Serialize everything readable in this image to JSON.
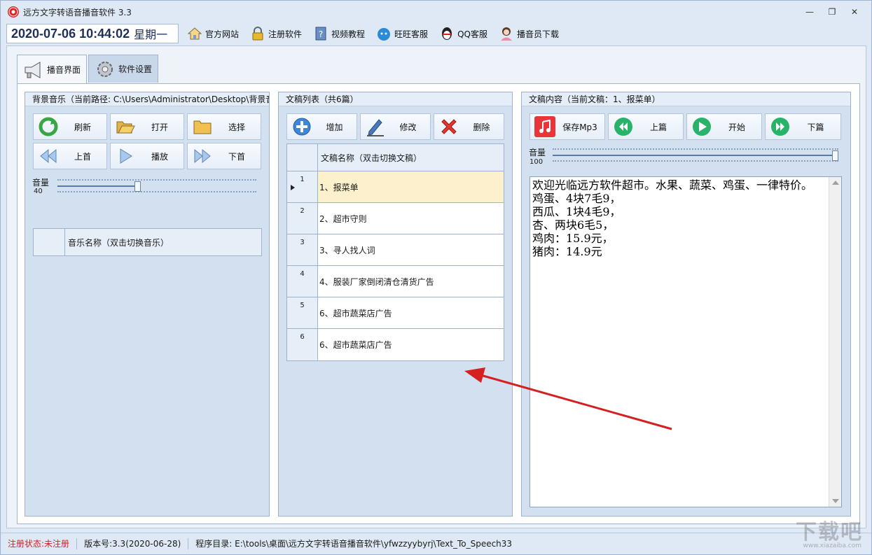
{
  "window": {
    "title": "远方文字转语音播音软件 3.3",
    "controls": {
      "minimize": "—",
      "restore": "❐",
      "close": "✕"
    }
  },
  "toolbar": {
    "datetime": "2020-07-06 10:44:02",
    "weekday": "星期一",
    "links": [
      {
        "label": "官方网站",
        "icon": "home-icon"
      },
      {
        "label": "注册软件",
        "icon": "lock-icon"
      },
      {
        "label": "视频教程",
        "icon": "help-book-icon"
      },
      {
        "label": "旺旺客服",
        "icon": "wangwang-icon"
      },
      {
        "label": "QQ客服",
        "icon": "qq-penguin-icon"
      },
      {
        "label": "播音员下载",
        "icon": "announcer-icon"
      }
    ]
  },
  "tabs": [
    {
      "label": "播音界面",
      "icon": "megaphone-icon",
      "active": true
    },
    {
      "label": "软件设置",
      "icon": "gear-icon",
      "active": false
    }
  ],
  "music_panel": {
    "title": "背景音乐（当前路径: C:\\Users\\Administrator\\Desktop\\背景音乐）",
    "buttons": [
      {
        "label": "刷新",
        "icon": "refresh-icon"
      },
      {
        "label": "打开",
        "icon": "open-folder-icon"
      },
      {
        "label": "选择",
        "icon": "folder-icon"
      },
      {
        "label": "上首",
        "icon": "previous-icon"
      },
      {
        "label": "播放",
        "icon": "play-icon"
      },
      {
        "label": "下首",
        "icon": "next-icon"
      }
    ],
    "volume_label": "音量",
    "volume": 40,
    "list_header": "音乐名称（双击切换音乐）"
  },
  "doc_panel": {
    "title": "文稿列表（共6篇）",
    "buttons": [
      {
        "label": "增加",
        "icon": "add-circle-icon"
      },
      {
        "label": "修改",
        "icon": "pencil-icon"
      },
      {
        "label": "删除",
        "icon": "delete-x-icon"
      }
    ],
    "header": "文稿名称（双击切换文稿）",
    "rows": [
      {
        "num": "1",
        "name": "1、报菜单",
        "selected": true
      },
      {
        "num": "2",
        "name": "2、超市守则",
        "selected": false
      },
      {
        "num": "3",
        "name": "3、寻人找人词",
        "selected": false
      },
      {
        "num": "4",
        "name": "4、服装厂家倒闭清仓清货广告",
        "selected": false
      },
      {
        "num": "5",
        "name": "6、超市蔬菜店广告",
        "selected": false
      },
      {
        "num": "6",
        "name": "6、超市蔬菜店广告",
        "selected": false
      }
    ]
  },
  "content_panel": {
    "title": "文稿内容（当前文稿：1、报菜单）",
    "buttons": [
      {
        "label": "保存Mp3",
        "icon": "music-note-icon"
      },
      {
        "label": "上篇",
        "icon": "rewind-icon"
      },
      {
        "label": "开始",
        "icon": "start-play-icon"
      },
      {
        "label": "下篇",
        "icon": "fast-forward-icon"
      }
    ],
    "volume_label": "音量",
    "volume": 100,
    "text": "欢迎光临远方软件超市。水果、蔬菜、鸡蛋、一律特价。\n鸡蛋、4块7毛9，\n西瓜、1块4毛9，\n杏、两块6毛5，\n鸡肉：15.9元，\n猪肉：14.9元"
  },
  "status": {
    "reg_label": "注册状态:",
    "reg_value": "未注册",
    "version": "版本号:3.3(2020-06-28)",
    "dir": "程序目录: E:\\tools\\桌面\\远方文字转语音播音软件\\yfwzzyybyrj\\Text_To_Speech33"
  },
  "watermark": {
    "main": "下载吧",
    "sub": "www.xiazaiba.com"
  },
  "colors": {
    "accent": "#2a8bd6",
    "status_red": "#d42020",
    "selected_row": "#fdf0cc",
    "arrow": "#d42020"
  }
}
